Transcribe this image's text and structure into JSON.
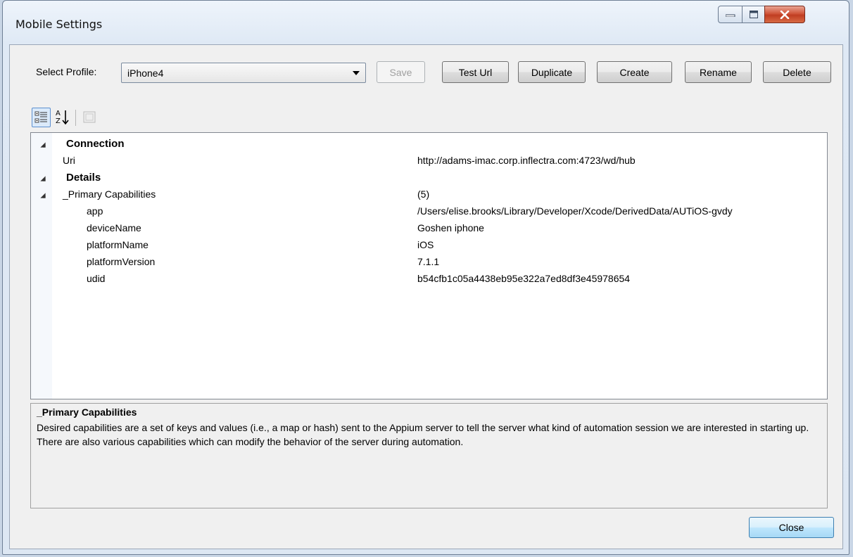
{
  "window": {
    "title": "Mobile Settings"
  },
  "profile": {
    "label": "Select Profile:",
    "selected": "iPhone4"
  },
  "buttons": {
    "save": "Save",
    "test_url": "Test Url",
    "duplicate": "Duplicate",
    "create": "Create",
    "rename": "Rename",
    "delete": "Delete",
    "close": "Close"
  },
  "toolbar": {
    "icons": [
      "categorized-icon",
      "alphabetical-sort-icon",
      "property-pages-icon"
    ]
  },
  "grid": {
    "rows": [
      {
        "type": "category",
        "name": "Connection",
        "value": ""
      },
      {
        "type": "property",
        "name": "Uri",
        "value": "http://adams-imac.corp.inflectra.com:4723/wd/hub"
      },
      {
        "type": "category",
        "name": "Details",
        "value": ""
      },
      {
        "type": "group",
        "name": "_Primary Capabilities",
        "value": "(5)"
      },
      {
        "type": "child",
        "name": "app",
        "value": "/Users/elise.brooks/Library/Developer/Xcode/DerivedData/AUTiOS-gvdy"
      },
      {
        "type": "child",
        "name": "deviceName",
        "value": "Goshen iphone"
      },
      {
        "type": "child",
        "name": "platformName",
        "value": "iOS"
      },
      {
        "type": "child",
        "name": "platformVersion",
        "value": "7.1.1"
      },
      {
        "type": "child",
        "name": "udid",
        "value": "b54cfb1c05a4438eb95e322a7ed8df3e45978654"
      }
    ]
  },
  "description": {
    "title": "_Primary Capabilities",
    "text": "Desired capabilities are a set of keys and values (i.e., a map or hash) sent to the Appium server to tell the server what kind of automation session we are interested in starting up. There are also various capabilities which can modify the behavior of the server during automation."
  },
  "colors": {
    "accent": "#3c7fb1",
    "close_button": "#c03d22"
  }
}
